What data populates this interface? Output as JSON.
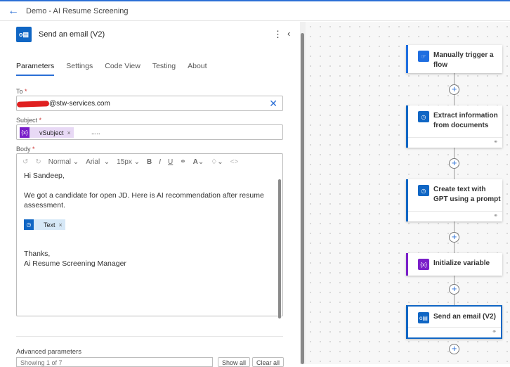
{
  "header": {
    "title": "Demo - AI Resume Screening"
  },
  "panel": {
    "title": "Send an email (V2)",
    "tabs": [
      "Parameters",
      "Settings",
      "Code View",
      "Testing",
      "About"
    ],
    "to": {
      "label": "To",
      "value": "@stw-services.com"
    },
    "subject": {
      "label": "Subject",
      "token": "vSubject",
      "suffix": "....."
    },
    "body": {
      "label": "Body",
      "toolbar": {
        "style": "Normal",
        "font": "Arial",
        "size": "15px"
      },
      "greeting": "Hi Sandeep,",
      "line1": "We got a candidate for open JD. Here is AI recommendation after resume",
      "line2": "assessment.",
      "token": "Text",
      "thanks": "Thanks,",
      "signature": "Ai Resume Screening Manager"
    },
    "advanced": {
      "label": "Advanced parameters",
      "select": "Showing 1 of 7",
      "show_all": "Show all",
      "clear_all": "Clear all"
    }
  },
  "flow": {
    "steps": [
      {
        "title": "Manually trigger a flow",
        "color": "#1f6ee0"
      },
      {
        "title": "Extract information from documents",
        "color": "#1066c4"
      },
      {
        "title": "Create text with GPT using a prompt",
        "color": "#1066c4"
      },
      {
        "title": "Initialize variable",
        "color": "#7a1fc9"
      },
      {
        "title": "Send an email (V2)",
        "color": "#1066c4"
      }
    ]
  }
}
